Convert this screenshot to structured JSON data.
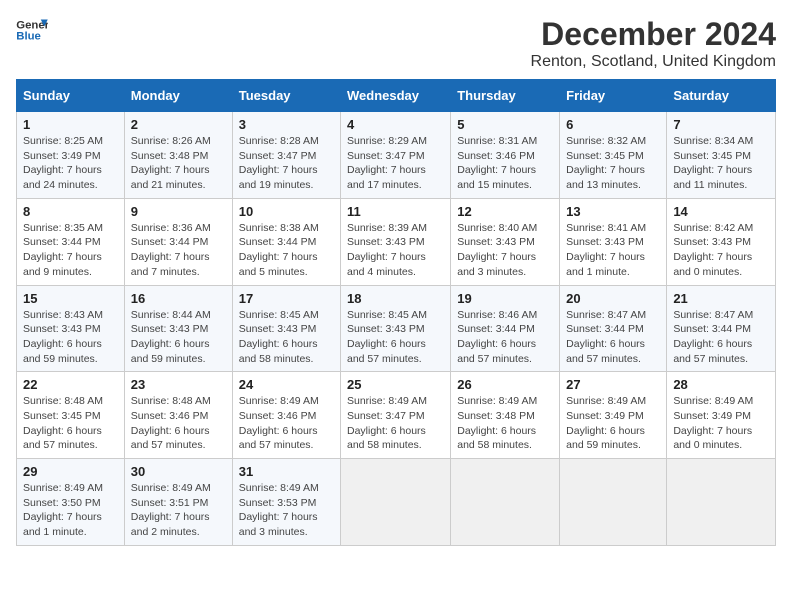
{
  "header": {
    "logo_line1": "General",
    "logo_line2": "Blue",
    "month_title": "December 2024",
    "location": "Renton, Scotland, United Kingdom"
  },
  "days_of_week": [
    "Sunday",
    "Monday",
    "Tuesday",
    "Wednesday",
    "Thursday",
    "Friday",
    "Saturday"
  ],
  "weeks": [
    [
      {
        "day": "1",
        "info": "Sunrise: 8:25 AM\nSunset: 3:49 PM\nDaylight: 7 hours\nand 24 minutes."
      },
      {
        "day": "2",
        "info": "Sunrise: 8:26 AM\nSunset: 3:48 PM\nDaylight: 7 hours\nand 21 minutes."
      },
      {
        "day": "3",
        "info": "Sunrise: 8:28 AM\nSunset: 3:47 PM\nDaylight: 7 hours\nand 19 minutes."
      },
      {
        "day": "4",
        "info": "Sunrise: 8:29 AM\nSunset: 3:47 PM\nDaylight: 7 hours\nand 17 minutes."
      },
      {
        "day": "5",
        "info": "Sunrise: 8:31 AM\nSunset: 3:46 PM\nDaylight: 7 hours\nand 15 minutes."
      },
      {
        "day": "6",
        "info": "Sunrise: 8:32 AM\nSunset: 3:45 PM\nDaylight: 7 hours\nand 13 minutes."
      },
      {
        "day": "7",
        "info": "Sunrise: 8:34 AM\nSunset: 3:45 PM\nDaylight: 7 hours\nand 11 minutes."
      }
    ],
    [
      {
        "day": "8",
        "info": "Sunrise: 8:35 AM\nSunset: 3:44 PM\nDaylight: 7 hours\nand 9 minutes."
      },
      {
        "day": "9",
        "info": "Sunrise: 8:36 AM\nSunset: 3:44 PM\nDaylight: 7 hours\nand 7 minutes."
      },
      {
        "day": "10",
        "info": "Sunrise: 8:38 AM\nSunset: 3:44 PM\nDaylight: 7 hours\nand 5 minutes."
      },
      {
        "day": "11",
        "info": "Sunrise: 8:39 AM\nSunset: 3:43 PM\nDaylight: 7 hours\nand 4 minutes."
      },
      {
        "day": "12",
        "info": "Sunrise: 8:40 AM\nSunset: 3:43 PM\nDaylight: 7 hours\nand 3 minutes."
      },
      {
        "day": "13",
        "info": "Sunrise: 8:41 AM\nSunset: 3:43 PM\nDaylight: 7 hours\nand 1 minute."
      },
      {
        "day": "14",
        "info": "Sunrise: 8:42 AM\nSunset: 3:43 PM\nDaylight: 7 hours\nand 0 minutes."
      }
    ],
    [
      {
        "day": "15",
        "info": "Sunrise: 8:43 AM\nSunset: 3:43 PM\nDaylight: 6 hours\nand 59 minutes."
      },
      {
        "day": "16",
        "info": "Sunrise: 8:44 AM\nSunset: 3:43 PM\nDaylight: 6 hours\nand 59 minutes."
      },
      {
        "day": "17",
        "info": "Sunrise: 8:45 AM\nSunset: 3:43 PM\nDaylight: 6 hours\nand 58 minutes."
      },
      {
        "day": "18",
        "info": "Sunrise: 8:45 AM\nSunset: 3:43 PM\nDaylight: 6 hours\nand 57 minutes."
      },
      {
        "day": "19",
        "info": "Sunrise: 8:46 AM\nSunset: 3:44 PM\nDaylight: 6 hours\nand 57 minutes."
      },
      {
        "day": "20",
        "info": "Sunrise: 8:47 AM\nSunset: 3:44 PM\nDaylight: 6 hours\nand 57 minutes."
      },
      {
        "day": "21",
        "info": "Sunrise: 8:47 AM\nSunset: 3:44 PM\nDaylight: 6 hours\nand 57 minutes."
      }
    ],
    [
      {
        "day": "22",
        "info": "Sunrise: 8:48 AM\nSunset: 3:45 PM\nDaylight: 6 hours\nand 57 minutes."
      },
      {
        "day": "23",
        "info": "Sunrise: 8:48 AM\nSunset: 3:46 PM\nDaylight: 6 hours\nand 57 minutes."
      },
      {
        "day": "24",
        "info": "Sunrise: 8:49 AM\nSunset: 3:46 PM\nDaylight: 6 hours\nand 57 minutes."
      },
      {
        "day": "25",
        "info": "Sunrise: 8:49 AM\nSunset: 3:47 PM\nDaylight: 6 hours\nand 58 minutes."
      },
      {
        "day": "26",
        "info": "Sunrise: 8:49 AM\nSunset: 3:48 PM\nDaylight: 6 hours\nand 58 minutes."
      },
      {
        "day": "27",
        "info": "Sunrise: 8:49 AM\nSunset: 3:49 PM\nDaylight: 6 hours\nand 59 minutes."
      },
      {
        "day": "28",
        "info": "Sunrise: 8:49 AM\nSunset: 3:49 PM\nDaylight: 7 hours\nand 0 minutes."
      }
    ],
    [
      {
        "day": "29",
        "info": "Sunrise: 8:49 AM\nSunset: 3:50 PM\nDaylight: 7 hours\nand 1 minute."
      },
      {
        "day": "30",
        "info": "Sunrise: 8:49 AM\nSunset: 3:51 PM\nDaylight: 7 hours\nand 2 minutes."
      },
      {
        "day": "31",
        "info": "Sunrise: 8:49 AM\nSunset: 3:53 PM\nDaylight: 7 hours\nand 3 minutes."
      },
      {
        "day": "",
        "info": ""
      },
      {
        "day": "",
        "info": ""
      },
      {
        "day": "",
        "info": ""
      },
      {
        "day": "",
        "info": ""
      }
    ]
  ]
}
